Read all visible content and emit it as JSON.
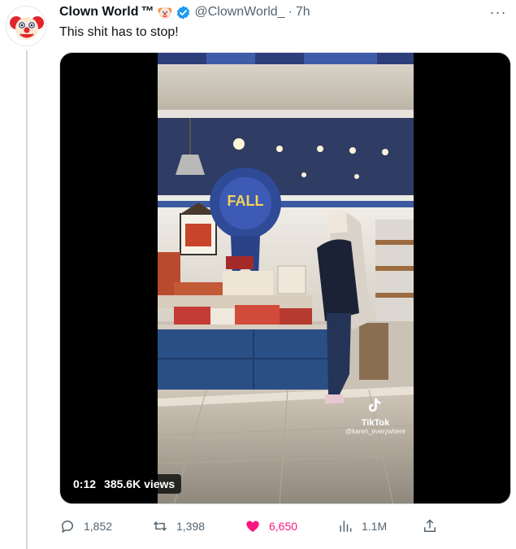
{
  "tweet": {
    "display_name": "Clown World",
    "tm": "™",
    "handle": "@ClownWorld_",
    "separator": "·",
    "time": "7h",
    "text": "This shit has to stop!",
    "more_label": "···"
  },
  "media": {
    "duration": "0:12",
    "views_text": "385.6K views",
    "watermark_brand": "TikTok",
    "watermark_user": "@karen_everywhere"
  },
  "actions": {
    "replies": "1,852",
    "retweets": "1,398",
    "likes": "6,650",
    "views": "1.1M"
  },
  "colors": {
    "like": "#f91880",
    "verified": "#1d9bf0",
    "muted": "#536471",
    "store_blue": "#2a4f86"
  },
  "icons": [
    "clown-avatar-icon",
    "clown-emoji-icon",
    "verified-badge-icon",
    "more-icon",
    "reply-icon",
    "retweet-icon",
    "heart-icon",
    "views-icon",
    "share-icon",
    "tiktok-logo-icon"
  ]
}
